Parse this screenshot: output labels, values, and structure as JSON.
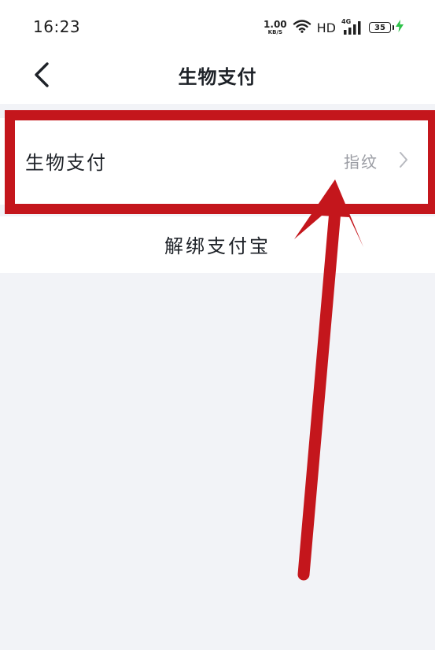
{
  "status_bar": {
    "time": "16:23",
    "net_speed_value": "1.00",
    "net_speed_unit": "KB/S",
    "hd_label": "HD",
    "network_type": "4G",
    "battery_level": "35",
    "icons": [
      "wifi-icon",
      "cellular-signal-icon",
      "battery-icon",
      "charging-bolt-icon"
    ]
  },
  "nav_bar": {
    "title": "生物支付",
    "back_icon": "chevron-left-icon"
  },
  "settings": {
    "bio_pay": {
      "label": "生物支付",
      "value": "指纹",
      "icon": "chevron-right-icon"
    },
    "unbind": {
      "label": "解绑支付宝"
    }
  },
  "annotation": {
    "highlight_color": "#c4161c",
    "shapes": [
      "highlight-box",
      "pointer-arrow"
    ]
  }
}
